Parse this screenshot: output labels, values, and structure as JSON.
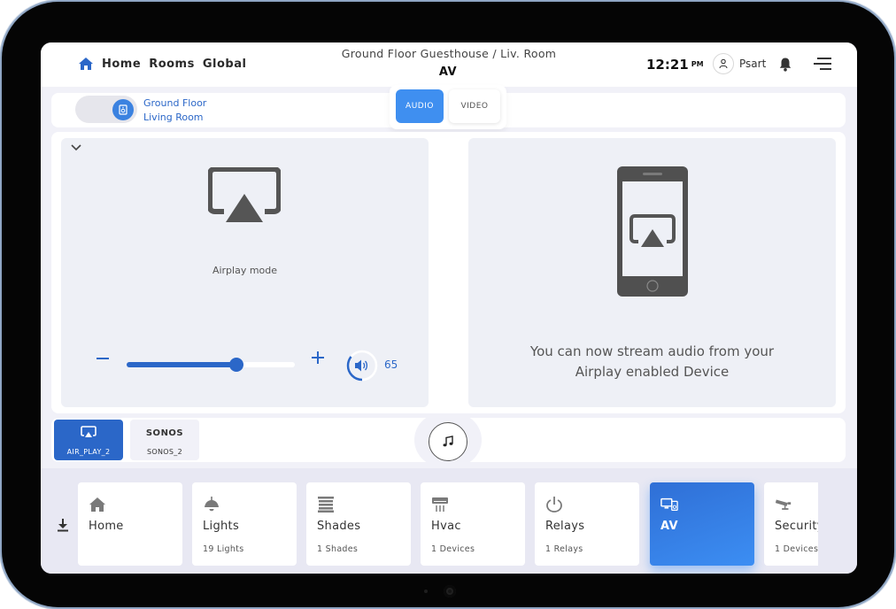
{
  "header": {
    "nav": [
      "Home",
      "Rooms",
      "Global"
    ],
    "breadcrumb": "Ground Floor Guesthouse / Liv. Room",
    "title": "AV",
    "time": "12:21",
    "ampm": "PM",
    "user": "Psart"
  },
  "room": {
    "floor": "Ground Floor",
    "name": "Living Room"
  },
  "av_tabs": [
    {
      "label": "AUDIO",
      "active": true
    },
    {
      "label": "VIDEO",
      "active": false
    }
  ],
  "player": {
    "mode_label": "Airplay mode",
    "volume": 65,
    "stream_line1": "You can now stream audio from your",
    "stream_line2": "Airplay enabled Device"
  },
  "sources": [
    {
      "title": "",
      "name": "AIR_PLAY_2",
      "active": true,
      "icon": "airplay-icon"
    },
    {
      "title": "SONOS",
      "name": "SONOS_2",
      "active": false
    }
  ],
  "dock": [
    {
      "title": "Home",
      "sub": "",
      "icon": "home-icon"
    },
    {
      "title": "Lights",
      "sub": "19 Lights",
      "icon": "lamp-icon"
    },
    {
      "title": "Shades",
      "sub": "1 Shades",
      "icon": "shades-icon"
    },
    {
      "title": "Hvac",
      "sub": "1 Devices",
      "icon": "hvac-icon"
    },
    {
      "title": "Relays",
      "sub": "1 Relays",
      "icon": "power-icon"
    },
    {
      "title": "AV",
      "sub": "",
      "icon": "av-icon",
      "active": true
    },
    {
      "title": "Security",
      "sub": "1 Devices",
      "icon": "camera-icon"
    }
  ],
  "colors": {
    "accent": "#2b67c8",
    "accent_light": "#3f8ff0",
    "panel": "#eef0f6",
    "background": "#f1f1f8"
  }
}
